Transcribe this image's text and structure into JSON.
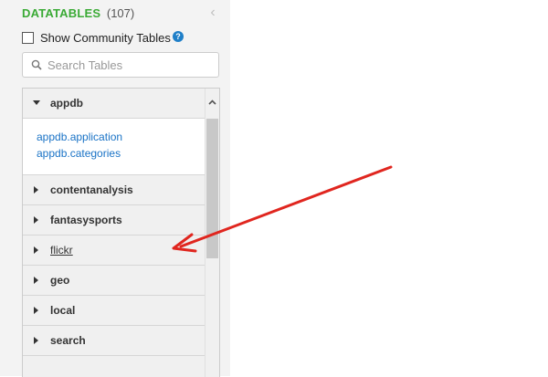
{
  "header": {
    "title": "DATATABLES",
    "count": "(107)",
    "collapse_icon": "chevron-left-icon"
  },
  "community": {
    "label": "Show Community Tables",
    "checked": false,
    "help_icon": "?"
  },
  "search": {
    "placeholder": "Search Tables",
    "value": ""
  },
  "databases": [
    {
      "name": "appdb",
      "expanded": true,
      "tables": [
        "appdb.application",
        "appdb.categories"
      ]
    },
    {
      "name": "contentanalysis",
      "expanded": false
    },
    {
      "name": "fantasysports",
      "expanded": false
    },
    {
      "name": "flickr",
      "expanded": false,
      "hovered": true
    },
    {
      "name": "geo",
      "expanded": false
    },
    {
      "name": "local",
      "expanded": false
    },
    {
      "name": "search",
      "expanded": false
    }
  ],
  "colors": {
    "title_green": "#3aaa35",
    "link_blue": "#1a73c6",
    "annotation_red": "#e0261f"
  }
}
